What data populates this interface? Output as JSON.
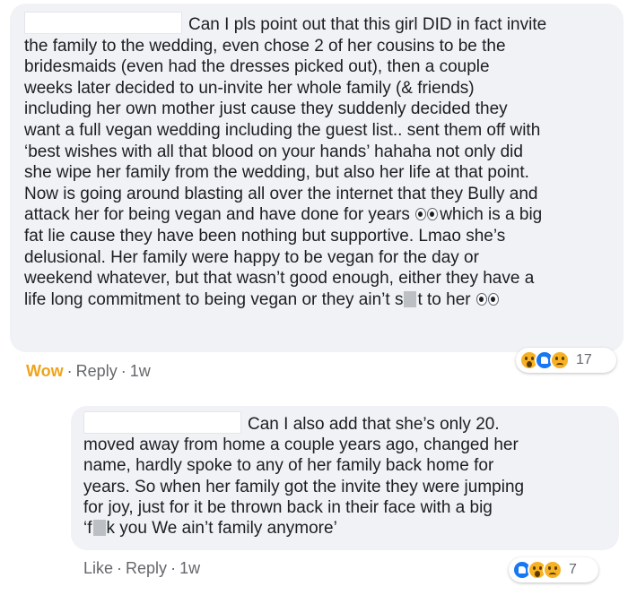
{
  "comments": [
    {
      "lines": [
        "Can I pls point out that this girl DID in fact invite",
        "the family to the wedding, even chose 2 of her cousins to be the",
        "bridesmaids (even had the dresses picked out), then a couple",
        "weeks later decided to un-invite her whole family (& friends)",
        "including her own mother just cause they suddenly decided they",
        "want a full vegan wedding including the guest list.. sent them off with",
        "‘best wishes with all that blood on your hands’ hahaha not only did",
        "she wipe her family from the wedding, but also her life at that point.",
        "Now is going around blasting all over the internet that they Bully and",
        "attack her for being vegan and have done for years",
        "which is a big",
        "fat lie cause they have been nothing but supportive. Lmao she’s",
        "delusional. Her family were happy to be vegan for the day or",
        "weekend whatever, but that wasn’t good enough, either they have a",
        "life long commitment to being vegan or they ain’t s",
        "t to her"
      ],
      "reaction_label": "Wow",
      "reply_label": "Reply",
      "age": "1w",
      "reaction_count": "17",
      "reaction_icons": [
        "wow-icon",
        "like-icon",
        "sad-icon"
      ]
    },
    {
      "lines": [
        "Can I also add that she’s only 20.",
        "moved away from home a couple years ago, changed her",
        "name, hardly spoke to any of her family back home for",
        "years. So when her family got the invite they were jumping",
        "for joy, just for it be thrown back in their face with a big",
        "‘f",
        "k you We ain’t family anymore’"
      ],
      "reaction_label": "Like",
      "reply_label": "Reply",
      "age": "1w",
      "reaction_count": "7",
      "reaction_icons": [
        "like-icon",
        "wow-icon",
        "sad-icon"
      ]
    }
  ],
  "separator": "·",
  "colors": {
    "bubble": "#f0f2f5",
    "text": "#1c1e21",
    "meta": "#65676b",
    "wow": "#f0a319",
    "like": "#1877f2"
  }
}
